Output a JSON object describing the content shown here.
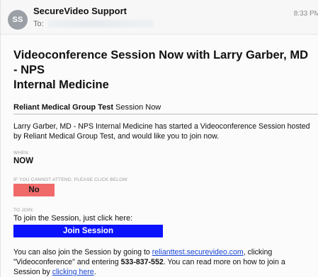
{
  "header": {
    "avatar_initials": "SS",
    "sender_name": "SecureVideo Support",
    "to_label": "To:",
    "time": "8:33 PM"
  },
  "message": {
    "title_line1": "Videoconference Session Now with Larry Garber, MD - NPS",
    "title_line2": "Internal Medicine",
    "section_org": "Reliant Medical Group Test",
    "section_rest": " Session Now",
    "intro_line1": "Larry Garber, MD - NPS Internal Medicine has started a Videoconference Session hosted",
    "intro_line2": "by Reliant Medical Group Test, and would like you to join now.",
    "when_label": "WHEN:",
    "when_value": "NOW",
    "cannot_attend_label": "IF YOU CANNOT ATTEND, PLEASE CLICK BELOW",
    "no_button_label": "No",
    "to_join_label": "TO JOIN:",
    "join_instruction": "To join the Session, just click here:",
    "join_button_label": "Join Session",
    "footer_part1": "You can also join the Session by going to ",
    "footer_link_site": "relianttest.securevideo.com",
    "footer_part2": ", clicking",
    "footer_part3": "\"Videoconference\" and entering ",
    "footer_code": "533-837-552",
    "footer_part4": ". You can read more on how to join a",
    "footer_part5": "Session by ",
    "footer_link_help": "clicking here",
    "footer_part6": "."
  },
  "colors": {
    "no_button": "#f06a6a",
    "join_button": "#0a12ff",
    "link": "#1a47d8"
  }
}
